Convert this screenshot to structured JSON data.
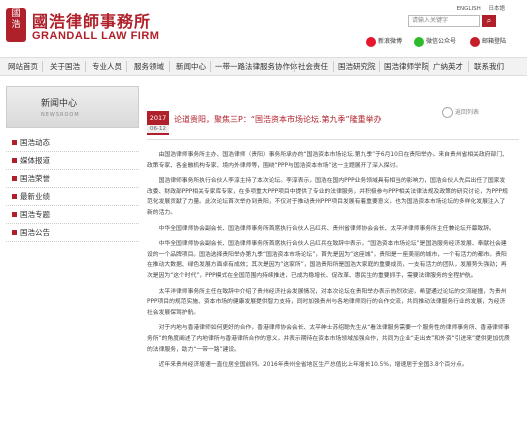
{
  "header": {
    "logo_cn": "國浩律師事務所",
    "logo_en": "GRANDALL LAW FIRM",
    "lang": [
      "ENGLISH",
      "日本語"
    ],
    "search_placeholder": "请输入关键字",
    "social": [
      {
        "label": "新浪微博",
        "icon": "weibo-icon",
        "color": "#e6162d"
      },
      {
        "label": "微信公众号",
        "icon": "wechat-icon",
        "color": "#2dbb2d"
      },
      {
        "label": "邮箱登陆",
        "icon": "mail-icon",
        "color": "#c41f2b"
      }
    ]
  },
  "nav": {
    "items": [
      "网站首页",
      "关于国浩",
      "专业人员",
      "服务领域",
      "新闻中心",
      "一带一路法律服务协作体",
      "社会责任",
      "国浩研究院",
      "国浩律师学院",
      "广纳英才",
      "联系我们"
    ]
  },
  "sidebar": {
    "title": "新闻中心",
    "subtitle": "NEWSROOM",
    "items": [
      "国浩动态",
      "媒体报道",
      "国浩荣誉",
      "最新业绩",
      "国浩专题",
      "国浩公告"
    ]
  },
  "article": {
    "back_label": "返回列表",
    "date_year": "2017",
    "date_md": "06-12",
    "title": "论道贵阳，聚焦三P：“国浩资本市场论坛.第九季”隆重举办",
    "paragraphs": [
      "由国浩律师事务所主办、国浩律师（贵阳）事务所承办的“国浩资本市场论坛.第九季”于6月10日在贵阳举办。来自贵州省相关政府部门、政策专家、各金融机构专家、境内外律师等，围绕“PPP与国浩资本市场”这一主题展开了深入探讨。",
      "国浩律师事务所执行合伙人李淳主持了本次论坛。李淳表示，国浩在国内PPP业务领域具有相当的影响力，国浩合伙人先后出任了国家发改委、财政部PPP相关专家库专家，在多项重大PPP项目中提供了专业的法律服务，并积极参与PPP相关法律法规及政策的研究讨论，为PPP规范化发展贡献了力量。此次论坛首次举办到贵阳，不仅对于推动贵州PPP项目发展有着重要意义，也为国浩资本市场论坛的多样化发展注入了新的活力。",
      "中华全国律师协会副会长、国浩律师事务所首席执行合伙人吕红兵、贵州省律师协会会长、太平洋律师事务所主任兼论坛开幕致辞。",
      "中华全国律师协会副会长、国浩律师事务所首席执行合伙人吕红兵在致辞中表示，“国浩资本市场论坛”是国浩服务经济发展、奉献社会建设的一个品牌项目。国浩选择贵阳举办第九季“国浩资本市场论坛”，首先是因为“这座城”，贵阳是一座美丽的城市，一个有活力的都市。贵阳在推动大数据、绿色发展方面卓有成效；其次是因为“这家所”，国浩贵阳所是国浩大家庭的重要成员，一支有活力的团队，发展势头强劲；再次是因为“这个时代”，PPP模式在全国范围内持续推进，已成为稳增长、促改革、惠民生的重要抓手，需要法律服务的全程护航。",
      "太平洋律师事务所主任在致辞中介绍了贵州经济社会发展情况，对本次论坛在贵阳举办表示热烈欢迎，希望通过论坛的交流碰撞，为贵州PPP项目的规范实施、资本市场的健康发展提供智力支持，同时加强贵州与各地律师同行的合作交流，共同推动法律服务行业的发展，为经济社会发展保驾护航。",
      "对于内地与香港律师如何更好的合作，香港律师协会会长、太平绅士苏绍聪先生从“看法律服务需要一个服务性的律师事务所、香港律师事务所”的角度阐述了内地律所与香港律所合作的意义，并表示期待在资本市场领域加强合作，共同为企业“走出去”和外资“引进来”提供更加优质的法律服务，助力“一带一路”建设。",
      "近年来贵州经济增速一直位居全国前列。2016年贵州全省地区生产总值比上年增长10.5%，增速居于全国3.8个百分点。"
    ]
  }
}
